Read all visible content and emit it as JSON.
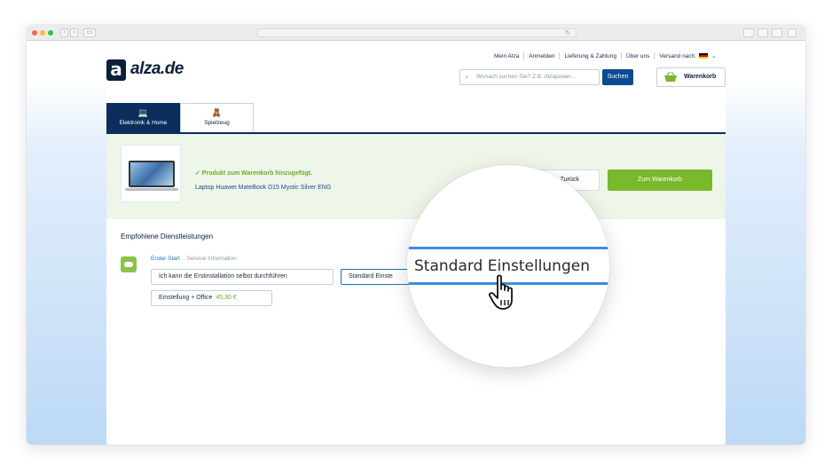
{
  "browser": {
    "controls": [
      "‹",
      "›",
      "▭"
    ],
    "reload_glyph": "↻"
  },
  "header": {
    "logo_mark": "a",
    "logo_name": "alza",
    "logo_tld": ".de",
    "nav": {
      "mein_alza": "Mein Alza",
      "anmelden": "Anmelden",
      "lieferung": "Lieferung & Zahlung",
      "ueber_uns": "Über uns",
      "versand": "Versand nach:"
    },
    "search_placeholder": "Wonach suchen Sie? Z.B. Alzapower...",
    "search_button": "Suchen",
    "cart_label": "Warenkorb"
  },
  "tabs": [
    {
      "label": "Elektronik & Home",
      "icon": "laptop-icon",
      "glyph": "💻"
    },
    {
      "label": "Spielzeug",
      "icon": "toy-icon",
      "glyph": "🧸"
    }
  ],
  "banner": {
    "added_message": "✓  Produkt zum Warenkorb hinzugefügt.",
    "product_name": "Laptop Huawei MateBook D15 Mystic Silver ENG",
    "back_button": "‹  Zurück",
    "cart_button": "Zum Warenkorb"
  },
  "services": {
    "title": "Empfohlene Dienstleistungen",
    "tab_start": "Erster Start",
    "tab_info": "Service Information",
    "options": [
      {
        "label": "Ich kann die Erstinstallation selbst durchführen"
      },
      {
        "label": "Standard Einste"
      },
      {
        "label": "Einstellung + Office",
        "price": "45,30 €"
      }
    ]
  },
  "magnifier": {
    "text": "Standard Einstellungen"
  },
  "colors": {
    "brand_navy": "#0b2e5c",
    "accent_green": "#7ab82c",
    "link_blue": "#1a6fbf"
  }
}
